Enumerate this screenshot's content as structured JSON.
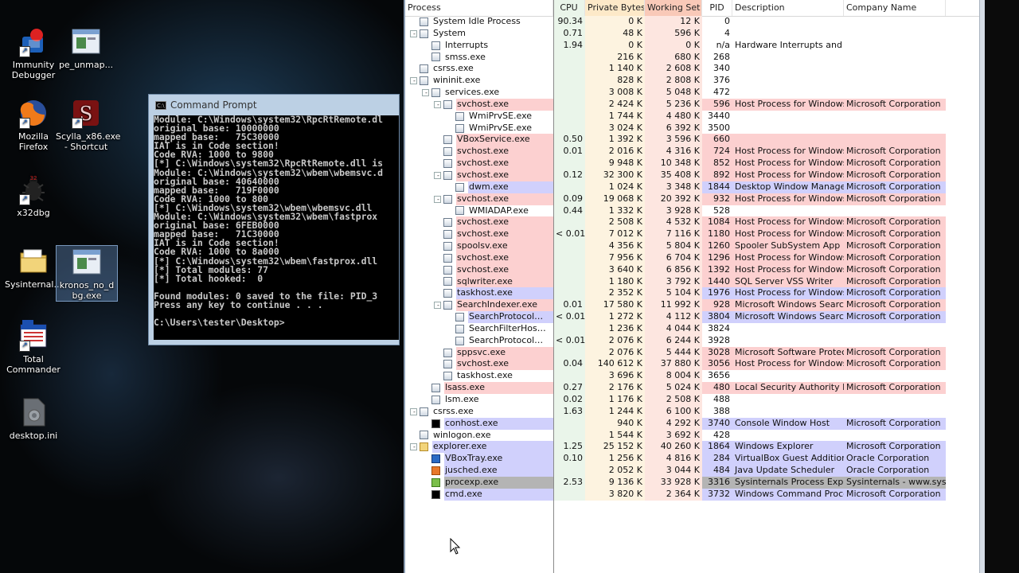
{
  "desktop": {
    "icons": [
      {
        "label": "Immunity\nDebugger",
        "icon": "immunity-debugger-icon"
      },
      {
        "label": "pe_unmap...",
        "icon": "window-icon"
      },
      {
        "label": "Mozilla\nFirefox",
        "icon": "firefox-icon"
      },
      {
        "label": "Scylla_x86.exe\n- Shortcut",
        "icon": "scylla-icon"
      },
      {
        "label": "x32dbg",
        "icon": "x32dbg-icon"
      },
      {
        "label": "Sysinternal...",
        "icon": "folder-icon"
      },
      {
        "label": "kronos_no_d\nbg.exe",
        "icon": "window-icon"
      },
      {
        "label": "Total\nCommander",
        "icon": "total-commander-icon"
      },
      {
        "label": "desktop.ini",
        "icon": "settings-file-icon"
      }
    ]
  },
  "cmd": {
    "title": "Command Prompt",
    "lines": [
      "Module: C:\\Windows\\system32\\RpcRtRemote.dl",
      "original base: 10000000",
      "mapped base:   75C30000",
      "IAT is in Code section!",
      "Code RVA: 1000 to 9800",
      "[*] C:\\Windows\\system32\\RpcRtRemote.dll is",
      "Module: C:\\Windows\\system32\\wbem\\wbemsvc.d",
      "original base: 40640000",
      "mapped base:   719F0000",
      "Code RVA: 1000 to 800",
      "[*] C:\\Windows\\system32\\wbem\\wbemsvc.dll",
      "Module: C:\\Windows\\system32\\wbem\\fastprox",
      "original base: 6FEB0000",
      "mapped base:   71C30000",
      "IAT is in Code section!",
      "Code RVA: 1000 to 8a000",
      "[*] C:\\Windows\\system32\\wbem\\fastprox.dll",
      "[*] Total modules: 77",
      "[*] Total hooked:  0",
      "",
      "Found modules: 0 saved to the file: PID_3",
      "Press any key to continue . . .",
      "",
      "C:\\Users\\tester\\Desktop>"
    ]
  },
  "procexp": {
    "columns": {
      "process": "Process",
      "cpu": "CPU",
      "private_bytes": "Private Bytes",
      "working_set": "Working Set",
      "pid": "PID",
      "description": "Description",
      "company": "Company Name"
    },
    "colors": {
      "service": "#fcd0d0",
      "own": "#d0d0fc",
      "selected": "#b4b4b4"
    },
    "rows": [
      {
        "indent": 0,
        "expander": "",
        "icon": "generic",
        "name": "System Idle Process",
        "cpu": "90.34",
        "priv": "0 K",
        "ws": "12 K",
        "pid": "0",
        "desc": "",
        "comp": "",
        "hl": ""
      },
      {
        "indent": 0,
        "expander": "-",
        "icon": "generic",
        "name": "System",
        "cpu": "0.71",
        "priv": "48 K",
        "ws": "596 K",
        "pid": "4",
        "desc": "",
        "comp": "",
        "hl": ""
      },
      {
        "indent": 1,
        "expander": "",
        "icon": "generic",
        "name": "Interrupts",
        "cpu": "1.94",
        "priv": "0 K",
        "ws": "0 K",
        "pid": "n/a",
        "desc": "Hardware Interrupts and DPCs",
        "comp": "",
        "hl": ""
      },
      {
        "indent": 1,
        "expander": "",
        "icon": "generic",
        "name": "smss.exe",
        "cpu": "",
        "priv": "216 K",
        "ws": "680 K",
        "pid": "268",
        "desc": "",
        "comp": "",
        "hl": ""
      },
      {
        "indent": 0,
        "expander": "",
        "icon": "generic",
        "name": "csrss.exe",
        "cpu": "",
        "priv": "1 140 K",
        "ws": "2 608 K",
        "pid": "340",
        "desc": "",
        "comp": "",
        "hl": ""
      },
      {
        "indent": 0,
        "expander": "-",
        "icon": "generic",
        "name": "wininit.exe",
        "cpu": "",
        "priv": "828 K",
        "ws": "2 808 K",
        "pid": "376",
        "desc": "",
        "comp": "",
        "hl": ""
      },
      {
        "indent": 1,
        "expander": "-",
        "icon": "generic",
        "name": "services.exe",
        "cpu": "",
        "priv": "3 008 K",
        "ws": "5 048 K",
        "pid": "472",
        "desc": "",
        "comp": "",
        "hl": ""
      },
      {
        "indent": 2,
        "expander": "-",
        "icon": "generic",
        "name": "svchost.exe",
        "cpu": "",
        "priv": "2 424 K",
        "ws": "5 236 K",
        "pid": "596",
        "desc": "Host Process for Windows S...",
        "comp": "Microsoft Corporation",
        "hl": "service"
      },
      {
        "indent": 3,
        "expander": "",
        "icon": "generic",
        "name": "WmiPrvSE.exe",
        "cpu": "",
        "priv": "1 744 K",
        "ws": "4 480 K",
        "pid": "3440",
        "desc": "",
        "comp": "",
        "hl": ""
      },
      {
        "indent": 3,
        "expander": "",
        "icon": "generic",
        "name": "WmiPrvSE.exe",
        "cpu": "",
        "priv": "3 024 K",
        "ws": "6 392 K",
        "pid": "3500",
        "desc": "",
        "comp": "",
        "hl": ""
      },
      {
        "indent": 2,
        "expander": "",
        "icon": "generic",
        "name": "VBoxService.exe",
        "cpu": "0.50",
        "priv": "1 392 K",
        "ws": "3 596 K",
        "pid": "660",
        "desc": "",
        "comp": "",
        "hl": "service"
      },
      {
        "indent": 2,
        "expander": "",
        "icon": "generic",
        "name": "svchost.exe",
        "cpu": "0.01",
        "priv": "2 016 K",
        "ws": "4 316 K",
        "pid": "724",
        "desc": "Host Process for Windows S...",
        "comp": "Microsoft Corporation",
        "hl": "service"
      },
      {
        "indent": 2,
        "expander": "",
        "icon": "generic",
        "name": "svchost.exe",
        "cpu": "",
        "priv": "9 948 K",
        "ws": "10 348 K",
        "pid": "852",
        "desc": "Host Process for Windows S...",
        "comp": "Microsoft Corporation",
        "hl": "service"
      },
      {
        "indent": 2,
        "expander": "-",
        "icon": "generic",
        "name": "svchost.exe",
        "cpu": "0.12",
        "priv": "32 300 K",
        "ws": "35 408 K",
        "pid": "892",
        "desc": "Host Process for Windows S...",
        "comp": "Microsoft Corporation",
        "hl": "service"
      },
      {
        "indent": 3,
        "expander": "",
        "icon": "generic",
        "name": "dwm.exe",
        "cpu": "",
        "priv": "1 024 K",
        "ws": "3 348 K",
        "pid": "1844",
        "desc": "Desktop Window Manager",
        "comp": "Microsoft Corporation",
        "hl": "own"
      },
      {
        "indent": 2,
        "expander": "-",
        "icon": "generic",
        "name": "svchost.exe",
        "cpu": "0.09",
        "priv": "19 068 K",
        "ws": "20 392 K",
        "pid": "932",
        "desc": "Host Process for Windows S...",
        "comp": "Microsoft Corporation",
        "hl": "service"
      },
      {
        "indent": 3,
        "expander": "",
        "icon": "generic",
        "name": "WMIADAP.exe",
        "cpu": "0.44",
        "priv": "1 332 K",
        "ws": "3 928 K",
        "pid": "528",
        "desc": "",
        "comp": "",
        "hl": ""
      },
      {
        "indent": 2,
        "expander": "",
        "icon": "generic",
        "name": "svchost.exe",
        "cpu": "",
        "priv": "2 508 K",
        "ws": "4 532 K",
        "pid": "1084",
        "desc": "Host Process for Windows S...",
        "comp": "Microsoft Corporation",
        "hl": "service"
      },
      {
        "indent": 2,
        "expander": "",
        "icon": "generic",
        "name": "svchost.exe",
        "cpu": "< 0.01",
        "priv": "7 012 K",
        "ws": "7 116 K",
        "pid": "1180",
        "desc": "Host Process for Windows S...",
        "comp": "Microsoft Corporation",
        "hl": "service"
      },
      {
        "indent": 2,
        "expander": "",
        "icon": "generic",
        "name": "spoolsv.exe",
        "cpu": "",
        "priv": "4 356 K",
        "ws": "5 804 K",
        "pid": "1260",
        "desc": "Spooler SubSystem App",
        "comp": "Microsoft Corporation",
        "hl": "service"
      },
      {
        "indent": 2,
        "expander": "",
        "icon": "generic",
        "name": "svchost.exe",
        "cpu": "",
        "priv": "7 956 K",
        "ws": "6 704 K",
        "pid": "1296",
        "desc": "Host Process for Windows S...",
        "comp": "Microsoft Corporation",
        "hl": "service"
      },
      {
        "indent": 2,
        "expander": "",
        "icon": "generic",
        "name": "svchost.exe",
        "cpu": "",
        "priv": "3 640 K",
        "ws": "6 856 K",
        "pid": "1392",
        "desc": "Host Process for Windows S...",
        "comp": "Microsoft Corporation",
        "hl": "service"
      },
      {
        "indent": 2,
        "expander": "",
        "icon": "generic",
        "name": "sqlwriter.exe",
        "cpu": "",
        "priv": "1 180 K",
        "ws": "3 792 K",
        "pid": "1440",
        "desc": "SQL Server VSS Writer",
        "comp": "Microsoft Corporation",
        "hl": "service"
      },
      {
        "indent": 2,
        "expander": "",
        "icon": "generic",
        "name": "taskhost.exe",
        "cpu": "",
        "priv": "2 352 K",
        "ws": "5 104 K",
        "pid": "1976",
        "desc": "Host Process for Windows T...",
        "comp": "Microsoft Corporation",
        "hl": "own"
      },
      {
        "indent": 2,
        "expander": "-",
        "icon": "generic",
        "name": "SearchIndexer.exe",
        "cpu": "0.01",
        "priv": "17 580 K",
        "ws": "11 992 K",
        "pid": "928",
        "desc": "Microsoft Windows Search I...",
        "comp": "Microsoft Corporation",
        "hl": "service"
      },
      {
        "indent": 3,
        "expander": "",
        "icon": "generic",
        "name": "SearchProtocolHost.e...",
        "cpu": "< 0.01",
        "priv": "1 272 K",
        "ws": "4 112 K",
        "pid": "3804",
        "desc": "Microsoft Windows Search P...",
        "comp": "Microsoft Corporation",
        "hl": "own"
      },
      {
        "indent": 3,
        "expander": "",
        "icon": "generic",
        "name": "SearchFilterHost.exe",
        "cpu": "",
        "priv": "1 236 K",
        "ws": "4 044 K",
        "pid": "3824",
        "desc": "",
        "comp": "",
        "hl": ""
      },
      {
        "indent": 3,
        "expander": "",
        "icon": "generic",
        "name": "SearchProtocolHost.e...",
        "cpu": "< 0.01",
        "priv": "2 076 K",
        "ws": "6 244 K",
        "pid": "3928",
        "desc": "",
        "comp": "",
        "hl": ""
      },
      {
        "indent": 2,
        "expander": "",
        "icon": "generic",
        "name": "sppsvc.exe",
        "cpu": "",
        "priv": "2 076 K",
        "ws": "5 444 K",
        "pid": "3028",
        "desc": "Microsoft Software Protectio...",
        "comp": "Microsoft Corporation",
        "hl": "service"
      },
      {
        "indent": 2,
        "expander": "",
        "icon": "generic",
        "name": "svchost.exe",
        "cpu": "0.04",
        "priv": "140 612 K",
        "ws": "37 880 K",
        "pid": "3056",
        "desc": "Host Process for Windows S...",
        "comp": "Microsoft Corporation",
        "hl": "service"
      },
      {
        "indent": 2,
        "expander": "",
        "icon": "generic",
        "name": "taskhost.exe",
        "cpu": "",
        "priv": "3 696 K",
        "ws": "8 004 K",
        "pid": "3656",
        "desc": "",
        "comp": "",
        "hl": ""
      },
      {
        "indent": 1,
        "expander": "",
        "icon": "generic",
        "name": "lsass.exe",
        "cpu": "0.27",
        "priv": "2 176 K",
        "ws": "5 024 K",
        "pid": "480",
        "desc": "Local Security Authority Proc...",
        "comp": "Microsoft Corporation",
        "hl": "service"
      },
      {
        "indent": 1,
        "expander": "",
        "icon": "generic",
        "name": "lsm.exe",
        "cpu": "0.02",
        "priv": "1 176 K",
        "ws": "2 508 K",
        "pid": "488",
        "desc": "",
        "comp": "",
        "hl": ""
      },
      {
        "indent": 0,
        "expander": "-",
        "icon": "generic",
        "name": "csrss.exe",
        "cpu": "1.63",
        "priv": "1 244 K",
        "ws": "6 100 K",
        "pid": "388",
        "desc": "",
        "comp": "",
        "hl": ""
      },
      {
        "indent": 1,
        "expander": "",
        "icon": "cmd",
        "name": "conhost.exe",
        "cpu": "",
        "priv": "940 K",
        "ws": "4 292 K",
        "pid": "3740",
        "desc": "Console Window Host",
        "comp": "Microsoft Corporation",
        "hl": "own"
      },
      {
        "indent": 0,
        "expander": "",
        "icon": "generic",
        "name": "winlogon.exe",
        "cpu": "",
        "priv": "1 544 K",
        "ws": "3 692 K",
        "pid": "428",
        "desc": "",
        "comp": "",
        "hl": ""
      },
      {
        "indent": 0,
        "expander": "-",
        "icon": "folder",
        "name": "explorer.exe",
        "cpu": "1.25",
        "priv": "25 152 K",
        "ws": "40 260 K",
        "pid": "1864",
        "desc": "Windows Explorer",
        "comp": "Microsoft Corporation",
        "hl": "own"
      },
      {
        "indent": 1,
        "expander": "",
        "icon": "vbox",
        "name": "VBoxTray.exe",
        "cpu": "0.10",
        "priv": "1 256 K",
        "ws": "4 816 K",
        "pid": "284",
        "desc": "VirtualBox Guest Additions Tr...",
        "comp": "Oracle Corporation",
        "hl": "own"
      },
      {
        "indent": 1,
        "expander": "",
        "icon": "java",
        "name": "jusched.exe",
        "cpu": "",
        "priv": "2 052 K",
        "ws": "3 044 K",
        "pid": "484",
        "desc": "Java Update Scheduler",
        "comp": "Oracle Corporation",
        "hl": "own"
      },
      {
        "indent": 1,
        "expander": "",
        "icon": "procexp",
        "name": "procexp.exe",
        "cpu": "2.53",
        "priv": "9 136 K",
        "ws": "33 928 K",
        "pid": "3316",
        "desc": "Sysinternals Process Explorer",
        "comp": "Sysinternals - www.sysinter...",
        "hl": "selected"
      },
      {
        "indent": 1,
        "expander": "",
        "icon": "cmd",
        "name": "cmd.exe",
        "cpu": "",
        "priv": "3 820 K",
        "ws": "2 364 K",
        "pid": "3732",
        "desc": "Windows Command Processor",
        "comp": "Microsoft Corporation",
        "hl": "own"
      }
    ]
  }
}
